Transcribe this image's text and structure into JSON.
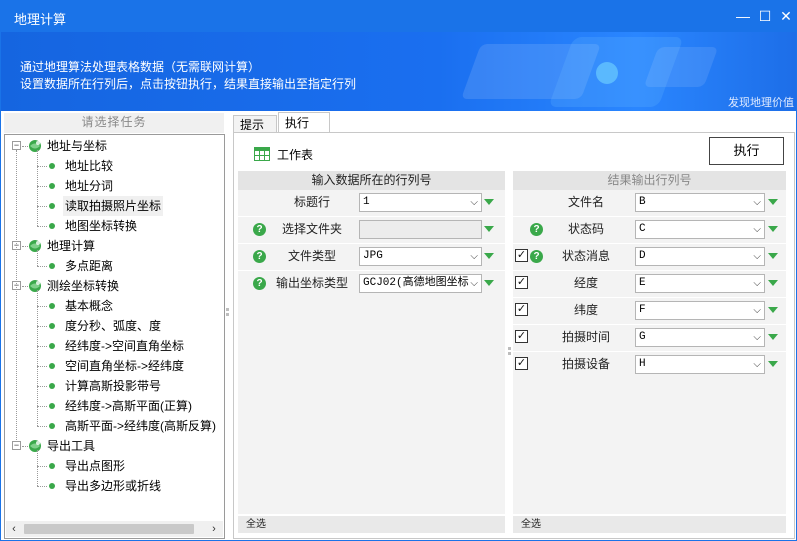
{
  "window": {
    "title": "地理计算",
    "controls": {
      "minimize": "—",
      "maximize": "☐",
      "close": "✕"
    }
  },
  "banner": {
    "line1": "通过地理算法处理表格数据（无需联网计算）",
    "line2": "设置数据所在行列后，点击按钮执行，结果直接输出至指定行列",
    "link": "发现地理价值"
  },
  "sidebar": {
    "header": "请选择任务",
    "groups": [
      {
        "label": "地址与坐标",
        "items": [
          "地址比较",
          "地址分词",
          "读取拍摄照片坐标",
          "地图坐标转换"
        ]
      },
      {
        "label": "地理计算",
        "items": [
          "多点距离"
        ]
      },
      {
        "label": "测绘坐标转换",
        "items": [
          "基本概念",
          "度分秒、弧度、度",
          "经纬度->空间直角坐标",
          "空间直角坐标->经纬度",
          "计算高斯投影带号",
          "经纬度->高斯平面(正算)",
          "高斯平面->经纬度(高斯反算)"
        ]
      },
      {
        "label": "导出工具",
        "items": [
          "导出点图形",
          "导出多边形或折线"
        ]
      }
    ],
    "selected": "读取拍摄照片坐标",
    "scroll_left": "‹",
    "scroll_right": "›"
  },
  "tabs": [
    {
      "label": "提示",
      "active": false
    },
    {
      "label": "执行",
      "active": true
    }
  ],
  "toolbar": {
    "worksheet_label": "工作表",
    "execute_label": "执行"
  },
  "input_section": {
    "header": "输入数据所在的行列号",
    "rows": [
      {
        "label": "标题行",
        "value": "1",
        "help": false,
        "disabled": false
      },
      {
        "label": "选择文件夹",
        "value": "",
        "help": true,
        "disabled": true
      },
      {
        "label": "文件类型",
        "value": "JPG",
        "help": true,
        "disabled": false
      },
      {
        "label": "输出坐标类型",
        "value": "GCJ02(高德地图坐标",
        "help": true,
        "disabled": false
      }
    ],
    "footer": "全选"
  },
  "output_section": {
    "header": "结果输出行列号",
    "rows": [
      {
        "label": "文件名",
        "value": "B",
        "checkbox": false,
        "help": false
      },
      {
        "label": "状态码",
        "value": "C",
        "checkbox": false,
        "help": true
      },
      {
        "label": "状态消息",
        "value": "D",
        "checkbox": true,
        "checked": true,
        "help": true
      },
      {
        "label": "经度",
        "value": "E",
        "checkbox": true,
        "checked": true,
        "help": false
      },
      {
        "label": "纬度",
        "value": "F",
        "checkbox": true,
        "checked": true,
        "help": false
      },
      {
        "label": "拍摄时间",
        "value": "G",
        "checkbox": true,
        "checked": true,
        "help": false
      },
      {
        "label": "拍摄设备",
        "value": "H",
        "checkbox": true,
        "checked": true,
        "help": false
      }
    ],
    "footer": "全选"
  },
  "colors": {
    "accent": "#1a73e8",
    "help_green": "#3aa84a"
  },
  "glyphs": {
    "help": "?",
    "check": "✓",
    "caret": "⌵"
  }
}
